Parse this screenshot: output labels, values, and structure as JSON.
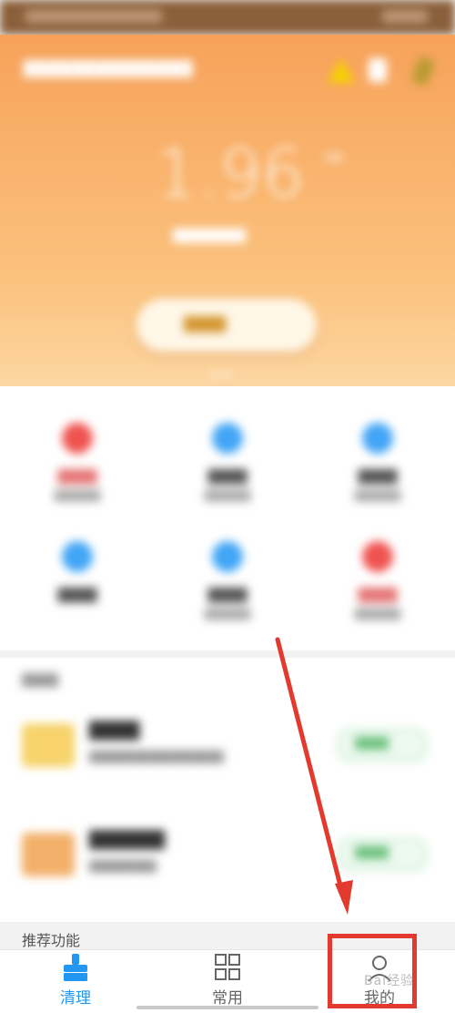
{
  "hero": {
    "title": "██████████████",
    "storage_value": "1.96",
    "storage_unit": "GB",
    "storage_desc": "████████",
    "cta_label": "████"
  },
  "grid": {
    "items": [
      {
        "label": "████",
        "sub": "██████",
        "color": "#ef5350"
      },
      {
        "label": "████",
        "sub": "██████",
        "color": "#42a5f5"
      },
      {
        "label": "████",
        "sub": "██████",
        "color": "#42a5f5"
      },
      {
        "label": "████",
        "sub": "",
        "color": "#42a5f5"
      },
      {
        "label": "████",
        "sub": "██████",
        "color": "#42a5f5"
      },
      {
        "label": "████",
        "sub": "██████",
        "color": "#ef5350"
      }
    ]
  },
  "feature_list": {
    "header": "████",
    "items": [
      {
        "title": "████",
        "desc": "████████████████",
        "button": "████",
        "image_color": "#f7d36a"
      },
      {
        "title": "██████",
        "desc": "████████",
        "button": "████",
        "image_color": "#f3b06a"
      }
    ]
  },
  "recommend_label": "推荐功能",
  "tabs": [
    {
      "label": "清理",
      "icon": "broom-icon",
      "active": true,
      "color": "#2196f3"
    },
    {
      "label": "常用",
      "icon": "grid-icon",
      "active": false,
      "color": "#666666"
    },
    {
      "label": "我的",
      "icon": "person-icon",
      "active": false,
      "color": "#666666"
    }
  ],
  "watermark": "Bai经验",
  "colors": {
    "accent": "#2196f3",
    "hero": "#f7a25a",
    "annotation": "#e23a2e"
  }
}
